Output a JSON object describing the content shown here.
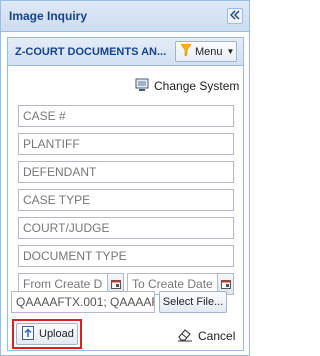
{
  "panel": {
    "title": "Image Inquiry",
    "collapse_icon": "double-chevron-left-icon"
  },
  "header": {
    "title": "Z-COURT DOCUMENTS AN...",
    "menu_label": "Menu",
    "menu_icon": "funnel-icon"
  },
  "change_system": {
    "label": "Change System",
    "icon": "monitor-icon"
  },
  "fields": {
    "case_number": "CASE #",
    "plantiff": "PLANTIFF",
    "defendant": "DEFENDANT",
    "case_type": "CASE TYPE",
    "court_judge": "COURT/JUDGE",
    "document_type": "DOCUMENT TYPE",
    "from_create_date": "From Create Da",
    "to_create_date": "To Create Date"
  },
  "file": {
    "value": "QAAAAFTX.001; QAAAAF",
    "select_label": "Select File..."
  },
  "actions": {
    "upload_label": "Upload",
    "cancel_label": "Cancel"
  },
  "colors": {
    "header_text": "#15428b",
    "border": "#99bbe8",
    "highlight": "#e02020",
    "funnel": "#f2b705"
  }
}
